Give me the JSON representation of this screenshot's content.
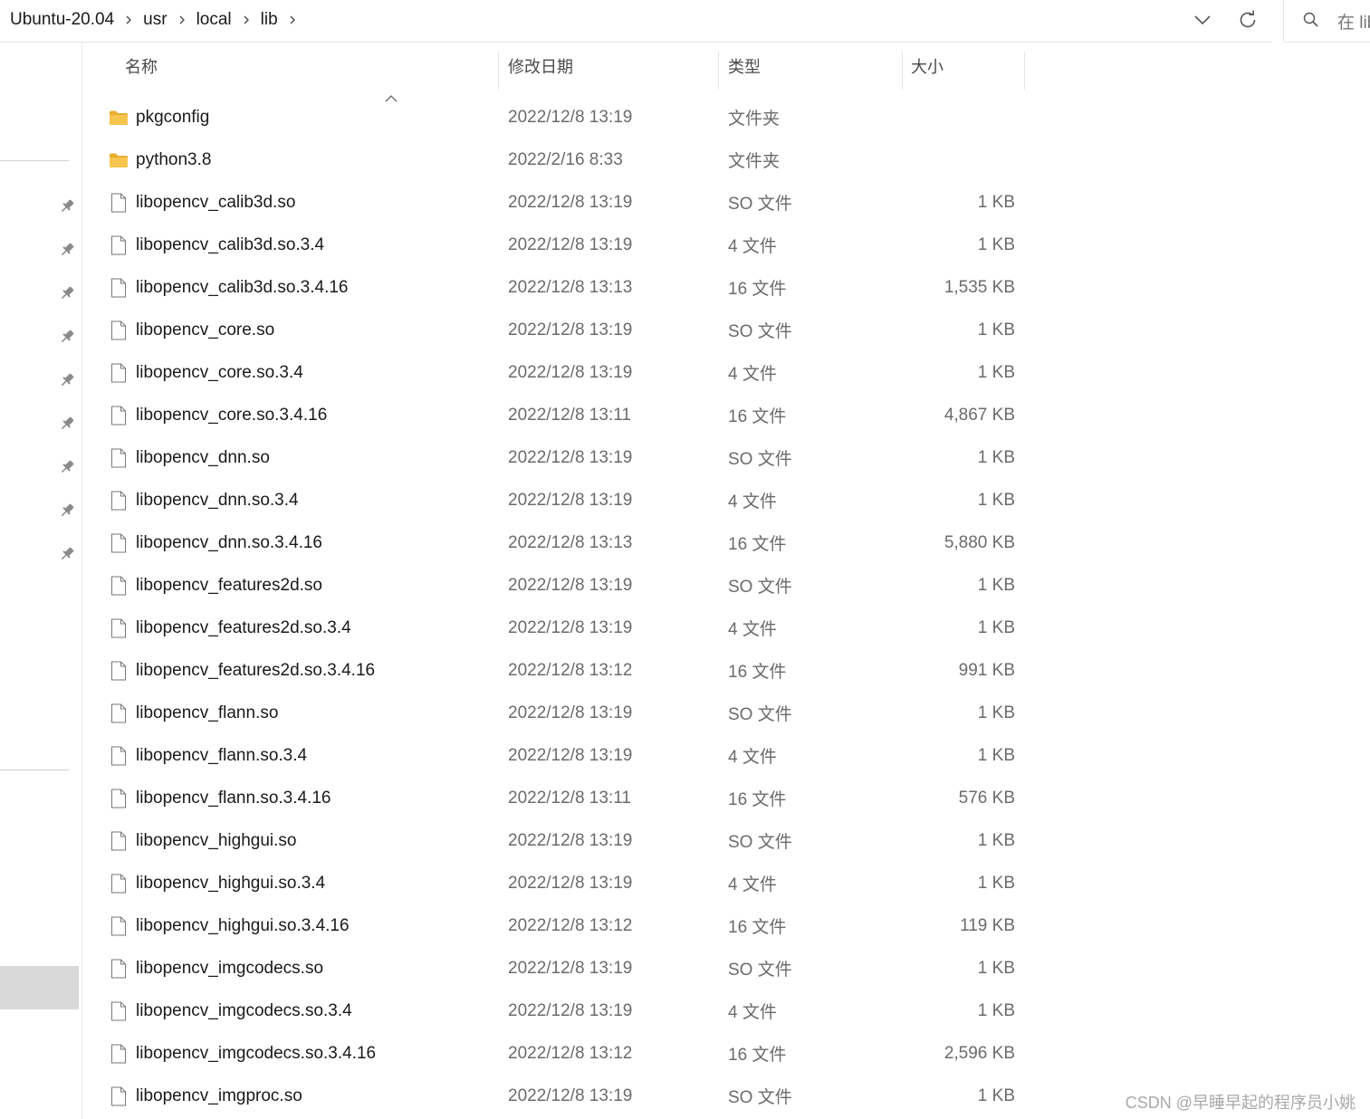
{
  "address_bar": {
    "breadcrumbs": [
      "Ubuntu-20.04",
      "usr",
      "local",
      "lib"
    ],
    "dropdown_icon": "chevron-down-icon",
    "refresh_icon": "refresh-icon"
  },
  "search": {
    "placeholder": "在 lib"
  },
  "columns": {
    "name": "名称",
    "date": "修改日期",
    "type": "类型",
    "size": "大小"
  },
  "sort": {
    "column": "name",
    "direction": "ascending"
  },
  "files": [
    {
      "name": "pkgconfig",
      "date": "2022/12/8 13:19",
      "type": "文件夹",
      "size": "",
      "icon": "folder-icon"
    },
    {
      "name": "python3.8",
      "date": "2022/2/16 8:33",
      "type": "文件夹",
      "size": "",
      "icon": "folder-icon"
    },
    {
      "name": "libopencv_calib3d.so",
      "date": "2022/12/8 13:19",
      "type": "SO 文件",
      "size": "1 KB",
      "icon": "file-icon"
    },
    {
      "name": "libopencv_calib3d.so.3.4",
      "date": "2022/12/8 13:19",
      "type": "4 文件",
      "size": "1 KB",
      "icon": "file-icon"
    },
    {
      "name": "libopencv_calib3d.so.3.4.16",
      "date": "2022/12/8 13:13",
      "type": "16 文件",
      "size": "1,535 KB",
      "icon": "file-icon"
    },
    {
      "name": "libopencv_core.so",
      "date": "2022/12/8 13:19",
      "type": "SO 文件",
      "size": "1 KB",
      "icon": "file-icon"
    },
    {
      "name": "libopencv_core.so.3.4",
      "date": "2022/12/8 13:19",
      "type": "4 文件",
      "size": "1 KB",
      "icon": "file-icon"
    },
    {
      "name": "libopencv_core.so.3.4.16",
      "date": "2022/12/8 13:11",
      "type": "16 文件",
      "size": "4,867 KB",
      "icon": "file-icon"
    },
    {
      "name": "libopencv_dnn.so",
      "date": "2022/12/8 13:19",
      "type": "SO 文件",
      "size": "1 KB",
      "icon": "file-icon"
    },
    {
      "name": "libopencv_dnn.so.3.4",
      "date": "2022/12/8 13:19",
      "type": "4 文件",
      "size": "1 KB",
      "icon": "file-icon"
    },
    {
      "name": "libopencv_dnn.so.3.4.16",
      "date": "2022/12/8 13:13",
      "type": "16 文件",
      "size": "5,880 KB",
      "icon": "file-icon"
    },
    {
      "name": "libopencv_features2d.so",
      "date": "2022/12/8 13:19",
      "type": "SO 文件",
      "size": "1 KB",
      "icon": "file-icon"
    },
    {
      "name": "libopencv_features2d.so.3.4",
      "date": "2022/12/8 13:19",
      "type": "4 文件",
      "size": "1 KB",
      "icon": "file-icon"
    },
    {
      "name": "libopencv_features2d.so.3.4.16",
      "date": "2022/12/8 13:12",
      "type": "16 文件",
      "size": "991 KB",
      "icon": "file-icon"
    },
    {
      "name": "libopencv_flann.so",
      "date": "2022/12/8 13:19",
      "type": "SO 文件",
      "size": "1 KB",
      "icon": "file-icon"
    },
    {
      "name": "libopencv_flann.so.3.4",
      "date": "2022/12/8 13:19",
      "type": "4 文件",
      "size": "1 KB",
      "icon": "file-icon"
    },
    {
      "name": "libopencv_flann.so.3.4.16",
      "date": "2022/12/8 13:11",
      "type": "16 文件",
      "size": "576 KB",
      "icon": "file-icon"
    },
    {
      "name": "libopencv_highgui.so",
      "date": "2022/12/8 13:19",
      "type": "SO 文件",
      "size": "1 KB",
      "icon": "file-icon"
    },
    {
      "name": "libopencv_highgui.so.3.4",
      "date": "2022/12/8 13:19",
      "type": "4 文件",
      "size": "1 KB",
      "icon": "file-icon"
    },
    {
      "name": "libopencv_highgui.so.3.4.16",
      "date": "2022/12/8 13:12",
      "type": "16 文件",
      "size": "119 KB",
      "icon": "file-icon"
    },
    {
      "name": "libopencv_imgcodecs.so",
      "date": "2022/12/8 13:19",
      "type": "SO 文件",
      "size": "1 KB",
      "icon": "file-icon"
    },
    {
      "name": "libopencv_imgcodecs.so.3.4",
      "date": "2022/12/8 13:19",
      "type": "4 文件",
      "size": "1 KB",
      "icon": "file-icon"
    },
    {
      "name": "libopencv_imgcodecs.so.3.4.16",
      "date": "2022/12/8 13:12",
      "type": "16 文件",
      "size": "2,596 KB",
      "icon": "file-icon"
    },
    {
      "name": "libopencv_imgproc.so",
      "date": "2022/12/8 13:19",
      "type": "SO 文件",
      "size": "1 KB",
      "icon": "file-icon"
    }
  ],
  "nav_pane": {
    "pinned_count": 9,
    "pin_icon": "pin-icon"
  },
  "watermark": "CSDN @早睡早起的程序员小姚",
  "colors": {
    "folder": "#F5C54E",
    "folder_dark": "#E8AE2C",
    "selection": "#D9D9D9",
    "text_secondary": "#6B6B6B"
  }
}
